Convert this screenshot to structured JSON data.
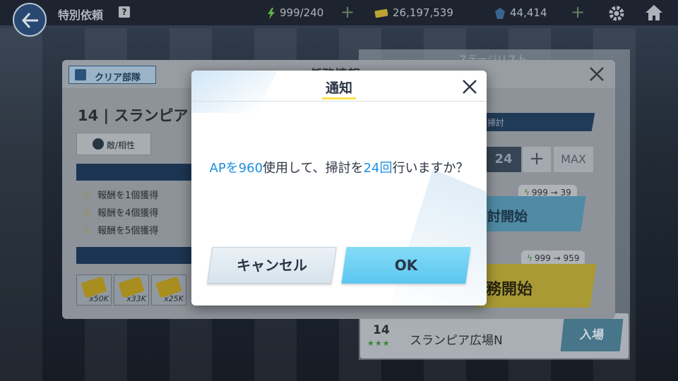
{
  "topbar": {
    "title": "特別依頼",
    "help": "?",
    "ap": "999/240",
    "credits": "26,197,539",
    "gems": "44,414"
  },
  "stage_list": {
    "title": "ステージリスト",
    "row": {
      "number": "14",
      "stars": "★★★",
      "name": "スランピア広場N",
      "enter_label": "入場"
    }
  },
  "mission": {
    "title": "任務情報",
    "clear_squad_label": "クリア部隊",
    "stage": "14 | スランピア",
    "enemy_label": "敵/相性",
    "rewards": [
      "報酬を1個獲得",
      "報酬を4個獲得",
      "報酬を5個獲得"
    ],
    "items": [
      {
        "qty": "x50K"
      },
      {
        "qty": "x33K"
      },
      {
        "qty": "x25K"
      }
    ],
    "sweep_label": "掃討",
    "sweep_count": "24",
    "plus": "+",
    "max_label": "MAX",
    "sweep_ap": "999 → 39",
    "sweep_start_label": "討開始",
    "mission_ap": "999 → 959",
    "mission_start_label": "務開始"
  },
  "dialog": {
    "title": "通知",
    "message_parts": {
      "p1": "APを",
      "p2": "960",
      "p3": "使用して、掃討を",
      "p4": "24回",
      "p5": "行いますか？"
    },
    "cancel_label": "キャンセル",
    "ok_label": "OK"
  },
  "colors": {
    "accent_blue": "#1d8fe0",
    "ok_button": "#5bc6f0",
    "title_underline": "#ffe14a"
  },
  "icons": {
    "back": "back-arrow-icon",
    "ap": "lightning-icon",
    "credits": "credit-icon",
    "gems": "gem-icon",
    "settings": "gear-icon",
    "home": "home-icon",
    "close": "close-icon",
    "star": "star-icon"
  }
}
